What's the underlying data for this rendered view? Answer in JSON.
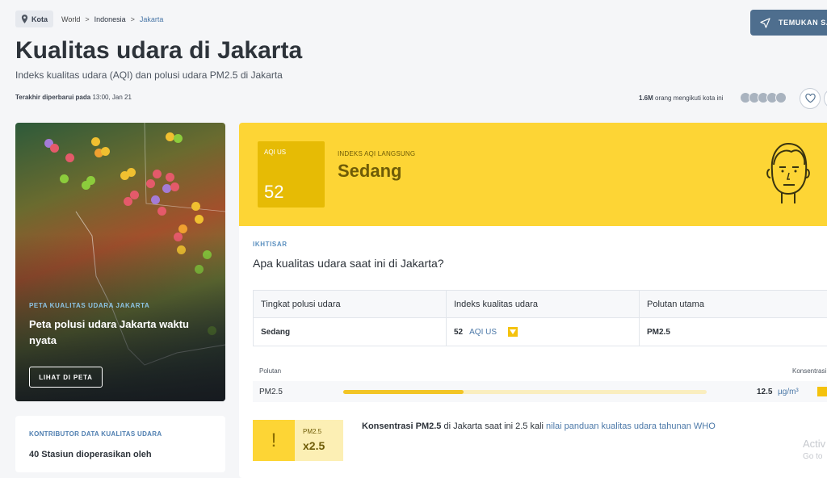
{
  "breadcrumb": {
    "kota_label": "Kota",
    "world": "World",
    "sep": ">",
    "country": "Indonesia",
    "city": "Jakarta"
  },
  "find_button": {
    "label": "TEMUKAN SA"
  },
  "header": {
    "title": "Kualitas udara di Jakarta",
    "subtitle": "Indeks kualitas udara (AQI) dan polusi udara PM2.5 di Jakarta",
    "updated_label": "Terakhir diperbarui pada",
    "updated_value": "13:00, Jan 21",
    "followers_count": "1.6M",
    "followers_text": "orang mengikuti kota ini"
  },
  "map_card": {
    "eyebrow": "PETA KUALITAS UDARA JAKARTA",
    "title": "Peta polusi udara Jakarta waktu nyata",
    "button": "LIHAT DI PETA"
  },
  "contributors": {
    "eyebrow": "KONTRIBUTOR DATA KUALITAS UDARA",
    "text": "40 Stasiun dioperasikan oleh"
  },
  "aqi": {
    "box_label": "AQI US",
    "value": "52",
    "live_label": "INDEKS AQI LANGSUNG",
    "level": "Sedang",
    "band_color": "#fdd535"
  },
  "overview": {
    "eyebrow": "IKHTISAR",
    "question": "Apa kualitas udara saat ini di Jakarta?",
    "table_headers": [
      "Tingkat polusi udara",
      "Indeks kualitas udara",
      "Polutan utama"
    ],
    "level": "Sedang",
    "aqi_value": "52",
    "aqi_unit": "AQI US",
    "main_pollutant": "PM2.5"
  },
  "pollutants": {
    "head_left": "Polutan",
    "head_right": "Konsentrasi",
    "rows": [
      {
        "name": "PM2.5",
        "value": "12.5",
        "unit": "µg/m³",
        "bar_fraction": 0.33
      }
    ]
  },
  "warning": {
    "icon": "!",
    "label": "PM2.5",
    "multiplier": "x2.5",
    "text_bold": "Konsentrasi PM2.5",
    "text_mid": " di Jakarta saat ini 2.5 kali ",
    "text_link": "nilai panduan kualitas udara tahunan WHO"
  },
  "watermark": {
    "line1": "Activ",
    "line2": "Go to"
  }
}
